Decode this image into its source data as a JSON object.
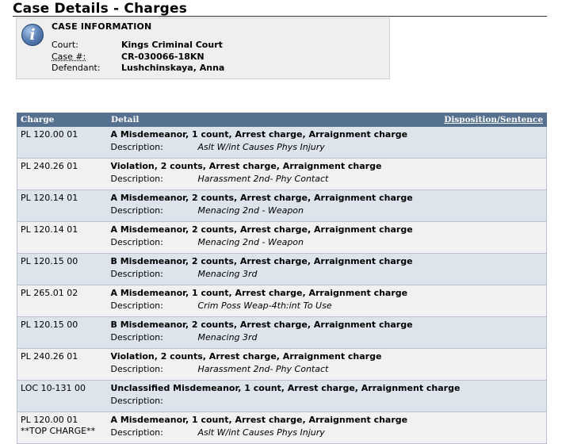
{
  "page": {
    "title": "Case Details - Charges"
  },
  "case_info": {
    "icon": "info-icon",
    "heading": "CASE INFORMATION",
    "court_label": "Court:",
    "court_value": "Kings Criminal Court",
    "case_label": "Case #:",
    "case_value": "CR-030066-18KN",
    "defendant_label": "Defendant:",
    "defendant_value": "Lushchinskaya, Anna"
  },
  "table": {
    "headers": {
      "charge": "Charge",
      "detail": "Detail",
      "disposition": "Disposition/Sentence"
    },
    "description_label": "Description:",
    "rows": [
      {
        "charge": "PL 120.00 01",
        "detail": "A Misdemeanor, 1 count, Arrest charge, Arraignment charge",
        "description": "Aslt W/int Causes Phys Injury"
      },
      {
        "charge": "PL 240.26 01",
        "detail": "Violation, 2 counts, Arrest charge, Arraignment charge",
        "description": "Harassment 2nd- Phy Contact"
      },
      {
        "charge": "PL 120.14 01",
        "detail": "A Misdemeanor, 2 counts, Arrest charge, Arraignment charge",
        "description": "Menacing 2nd - Weapon"
      },
      {
        "charge": "PL 120.14 01",
        "detail": "A Misdemeanor, 2 counts, Arrest charge, Arraignment charge",
        "description": "Menacing 2nd - Weapon"
      },
      {
        "charge": "PL 120.15 00",
        "detail": "B Misdemeanor, 2 counts, Arrest charge, Arraignment charge",
        "description": "Menacing 3rd"
      },
      {
        "charge": "PL 265.01 02",
        "detail": "A Misdemeanor, 1 count, Arrest charge, Arraignment charge",
        "description": "Crim Poss Weap-4th:int To Use"
      },
      {
        "charge": "PL 120.15 00",
        "detail": "B Misdemeanor, 2 counts, Arrest charge, Arraignment charge",
        "description": "Menacing 3rd"
      },
      {
        "charge": "PL 240.26 01",
        "detail": "Violation, 2 counts, Arrest charge, Arraignment charge",
        "description": "Harassment 2nd- Phy Contact"
      },
      {
        "charge": "LOC 10-131 00",
        "detail": "Unclassified Misdemeanor, 1 count, Arrest charge, Arraignment charge",
        "description": ""
      },
      {
        "charge": "PL 120.00 01",
        "charge_note": "**TOP CHARGE**",
        "detail": "A Misdemeanor, 1 count, Arrest charge, Arraignment charge",
        "description": "Aslt W/int Causes Phys Injury"
      }
    ]
  },
  "colors": {
    "header_bg": "#56708f",
    "row_odd_bg": "#dde4ec",
    "row_even_bg": "#f1f1f4",
    "info_box_bg": "#efefef"
  }
}
